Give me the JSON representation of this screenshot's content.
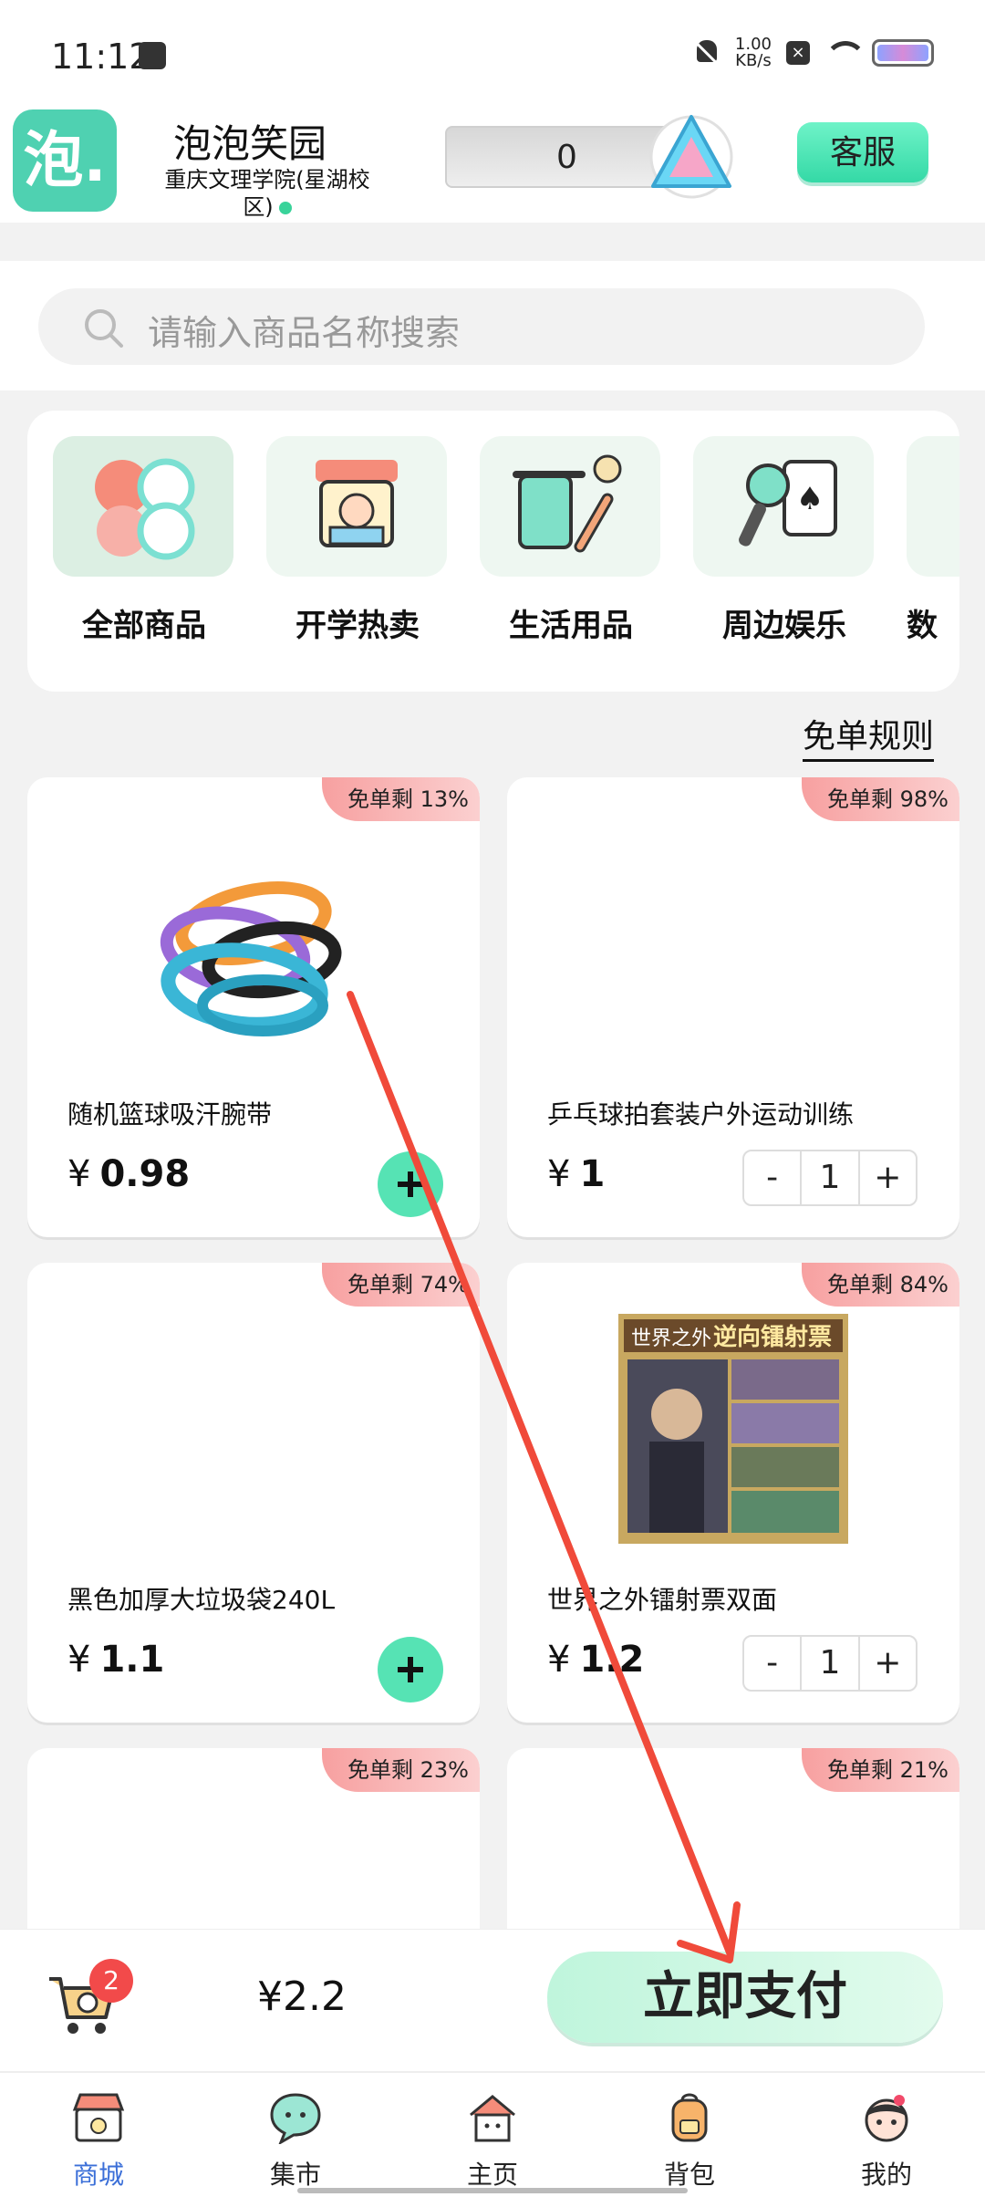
{
  "status_bar": {
    "time": "11:12",
    "net_speed_value": "1.00",
    "net_speed_unit": "KB/s"
  },
  "header": {
    "store_name": "泡泡笑园",
    "campus": "重庆文理学院(星湖校区)",
    "logo_char": "泡.",
    "coin_value": "0",
    "service_label": "客服"
  },
  "search": {
    "placeholder": "请输入商品名称搜索"
  },
  "categories": [
    {
      "label": "全部商品",
      "icon": "clover-icon"
    },
    {
      "label": "开学热卖",
      "icon": "hot-sale-stall-icon"
    },
    {
      "label": "生活用品",
      "icon": "towel-toothbrush-icon"
    },
    {
      "label": "周边娱乐",
      "icon": "microphone-cards-icon"
    },
    {
      "label": "数",
      "icon": "gamepad-icon"
    }
  ],
  "rules_label": "免单规则",
  "products": [
    {
      "name": "随机篮球吸汗腕带",
      "currency": "¥",
      "price": "0.98",
      "badge": "免单剩 13%",
      "control": "add"
    },
    {
      "name": "乒乓球拍套装户外运动训练",
      "currency": "¥",
      "price": "1",
      "badge": "免单剩 98%",
      "control": "stepper",
      "qty": "1"
    },
    {
      "name": "黑色加厚大垃圾袋240L",
      "currency": "¥",
      "price": "1.1",
      "badge": "免单剩 74%",
      "control": "add"
    },
    {
      "name": "世界之外镭射票双面",
      "currency": "¥",
      "price": "1.2",
      "badge": "免单剩 84%",
      "control": "stepper",
      "qty": "1"
    },
    {
      "badge": "免单剩 23%"
    },
    {
      "badge": "免单剩 21%"
    }
  ],
  "stepper_labels": {
    "minus": "-",
    "plus": "+"
  },
  "cart": {
    "count": "2",
    "total": "¥2.2",
    "pay_label": "立即支付"
  },
  "product_image_text": {
    "ticket_title": "逆向镭射票",
    "ticket_prefix": "世界之外"
  },
  "tabs": [
    {
      "label": "商城",
      "active": true,
      "icon": "store-icon"
    },
    {
      "label": "集市",
      "active": false,
      "icon": "chat-bubble-icon"
    },
    {
      "label": "主页",
      "active": false,
      "icon": "house-icon"
    },
    {
      "label": "背包",
      "active": false,
      "icon": "backpack-icon"
    },
    {
      "label": "我的",
      "active": false,
      "icon": "profile-avatar-icon"
    }
  ],
  "colors": {
    "brand": "#4fd1b1",
    "accent": "#56e3b4",
    "badge_red": "#f7a0a0",
    "annotation": "#f04a3a",
    "active_tab": "#3b6fd8"
  }
}
